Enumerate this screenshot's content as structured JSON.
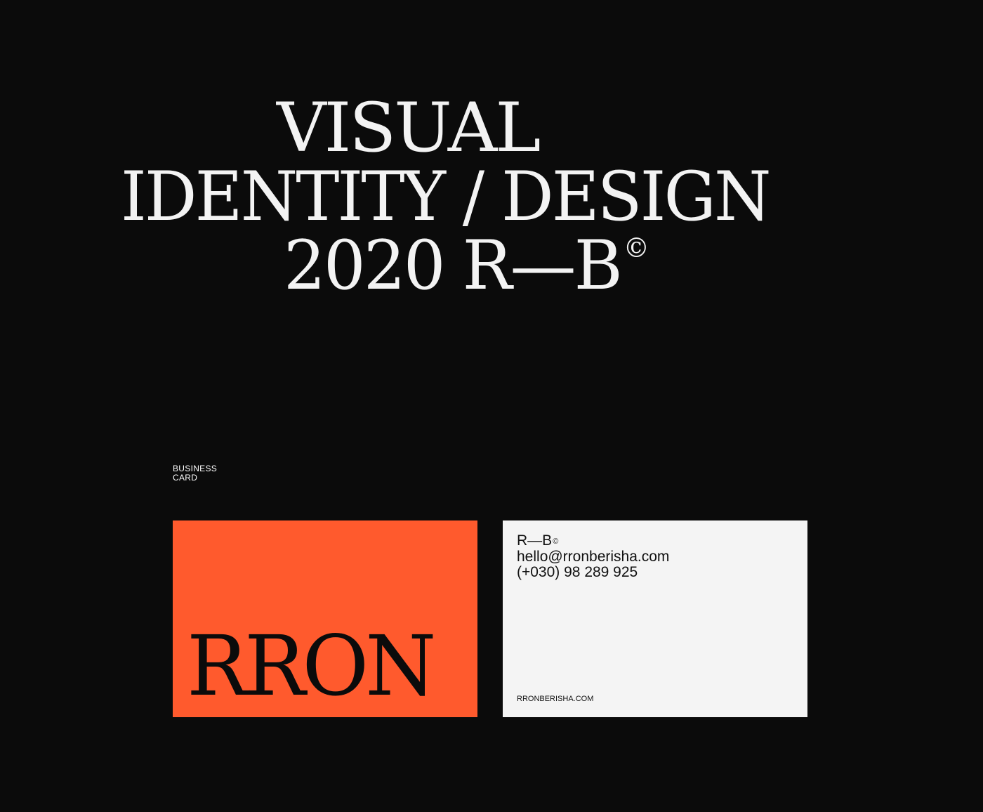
{
  "headline": {
    "line1": "VISUAL",
    "line2": "IDENTITY / DESIGN",
    "line3": "2020 R—B",
    "line3_mark": "©"
  },
  "section": {
    "label_line1": "BUSINESS",
    "label_line2": "CARD"
  },
  "business_card": {
    "front": {
      "logo_text": "RRON",
      "background_color": "#ff5a2d"
    },
    "back": {
      "brand": "R—B",
      "brand_mark": "©",
      "email": "hello@rronberisha.com",
      "phone": "(+030) 98 289 925",
      "website": "RRONBERISHA.COM",
      "background_color": "#f4f4f4"
    }
  }
}
